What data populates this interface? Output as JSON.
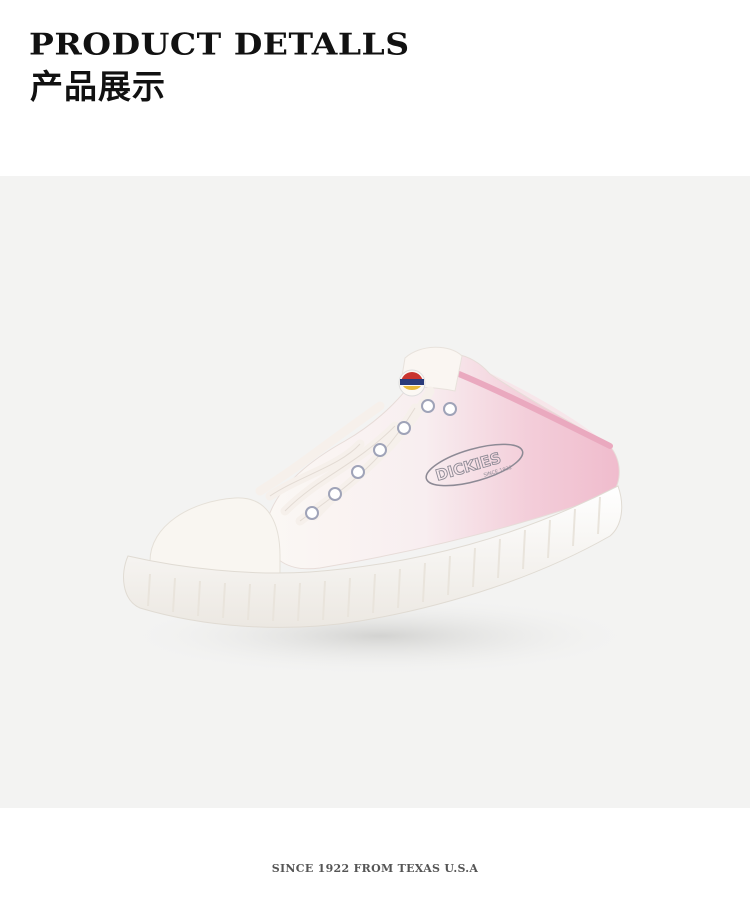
{
  "header": {
    "title_en": "PRODUCT DETALLS",
    "title_cn": "产品展示"
  },
  "product": {
    "brand_mark": "DICKIES",
    "brand_sub": "SINCE 1922",
    "colors": {
      "pink": "#f2c3d2",
      "white": "#fbf8f4",
      "background": "#f3f3f2"
    }
  },
  "footer": {
    "tagline": "SINCE 1922 FROM TEXAS U.S.A"
  }
}
